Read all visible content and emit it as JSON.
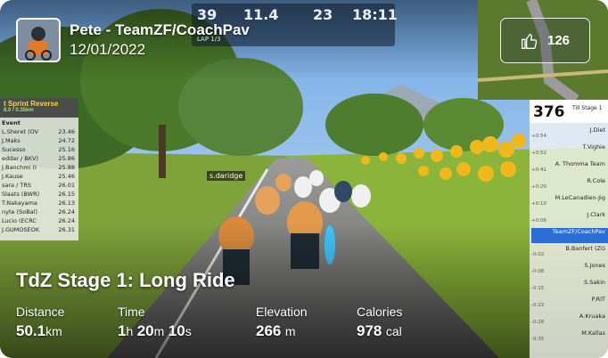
{
  "header": {
    "rider_name": "Pete - TeamZF/CoachPav",
    "date": "12/01/2022"
  },
  "likes": {
    "icon": "thumbs-up-icon",
    "count": "126"
  },
  "game_hud": {
    "power": "39",
    "distance": "11.4",
    "speed": "23",
    "time": "18:11",
    "lap": "LAP 1/3",
    "nameplate": "s.daridge"
  },
  "left_leaderboard": {
    "title": "t Sprint Reverse",
    "subtitle": "8.0 / 0.35km",
    "column": "Event",
    "rows": [
      {
        "name": "L.Sheret (OV",
        "value": "23.46"
      },
      {
        "name": "J.Maks",
        "value": "24.72"
      },
      {
        "name": "Sucesso",
        "value": "25.16"
      },
      {
        "name": "eddar / BKV)",
        "value": "25.86"
      },
      {
        "name": "J.Banchmi (I",
        "value": "25.88"
      },
      {
        "name": "J.Kause",
        "value": "25.46"
      },
      {
        "name": "sara / TRS",
        "value": "26.01"
      },
      {
        "name": "Slaats (BWR)",
        "value": "26.15"
      },
      {
        "name": "T.Nakayama",
        "value": "26.13"
      },
      {
        "name": "nyte (SoBal)",
        "value": "26.24"
      },
      {
        "name": "Lucio (ECRC",
        "value": "26.24"
      },
      {
        "name": "J.GUMOSEOK",
        "value": "26.31"
      }
    ]
  },
  "right_leaderboard": {
    "rank": "376",
    "total": "Till Stage 1",
    "rows": [
      {
        "name": "J.Diet",
        "gap": "+0:54",
        "highlight": false
      },
      {
        "name": "T.Vighie",
        "gap": "+0:52",
        "highlight": false
      },
      {
        "name": "A. Thomma Team",
        "gap": "+0:41",
        "highlight": false
      },
      {
        "name": "R.Cole",
        "gap": "+0:20",
        "highlight": false
      },
      {
        "name": "M.LeCanadien-Jig",
        "gap": "+0:10",
        "highlight": false
      },
      {
        "name": "J.Clark",
        "gap": "+0:06",
        "highlight": false
      },
      {
        "name": "TeamZF/CoachPav",
        "gap": "",
        "highlight": true
      },
      {
        "name": "B.Banfert (ZG",
        "gap": "-0:02",
        "highlight": false
      },
      {
        "name": "S.Jones",
        "gap": "-0:08",
        "highlight": false
      },
      {
        "name": "S.Sakin",
        "gap": "-0:15",
        "highlight": false
      },
      {
        "name": "P.RIT",
        "gap": "-0:22",
        "highlight": false
      },
      {
        "name": "A.Kruaka",
        "gap": "-0:28",
        "highlight": false
      },
      {
        "name": "M.Kallas",
        "gap": "-0:35",
        "highlight": false
      }
    ]
  },
  "ride": {
    "title": "TdZ Stage 1: Long Ride"
  },
  "stats": {
    "distance": {
      "label": "Distance",
      "value": "50.1",
      "unit": "km"
    },
    "time": {
      "label": "Time",
      "h": "1",
      "h_unit": "h",
      "m": "20",
      "m_unit": "m",
      "s": "10",
      "s_unit": "s"
    },
    "elevation": {
      "label": "Elevation",
      "value": "266",
      "unit": "m"
    },
    "calories": {
      "label": "Calories",
      "value": "978",
      "unit": "cal"
    }
  }
}
